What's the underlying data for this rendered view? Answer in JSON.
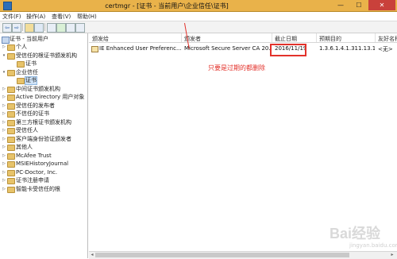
{
  "window": {
    "title": "certmgr - [证书 - 当前用户\\企业信任\\证书]",
    "minimize": "—",
    "maximize": "☐",
    "close": "✕"
  },
  "menu": [
    "文件(F)",
    "操作(A)",
    "查看(V)",
    "帮助(H)"
  ],
  "toolbar": {
    "buttons": [
      "back",
      "forward",
      "up-folder",
      "show-tree",
      "copy",
      "refresh",
      "export",
      "help"
    ],
    "back_glyph": "⇦",
    "forward_glyph": "⇨"
  },
  "tree": {
    "root": "证书 - 当前用户",
    "items": [
      {
        "label": "个人",
        "level": 1,
        "expander": "▷"
      },
      {
        "label": "受信任的根证书颁发机构",
        "level": 1,
        "expander": "▾"
      },
      {
        "label": "证书",
        "level": 2,
        "expander": ""
      },
      {
        "label": "企业信任",
        "level": 1,
        "expander": "▾"
      },
      {
        "label": "证书",
        "level": 2,
        "expander": "",
        "selected": true
      },
      {
        "label": "中间证书颁发机构",
        "level": 1,
        "expander": "▷"
      },
      {
        "label": "Active Directory 用户对象",
        "level": 1,
        "expander": "▷"
      },
      {
        "label": "受信任的发布者",
        "level": 1,
        "expander": "▷"
      },
      {
        "label": "不信任的证书",
        "level": 1,
        "expander": "▷"
      },
      {
        "label": "第三方根证书颁发机构",
        "level": 1,
        "expander": "▷"
      },
      {
        "label": "受信任人",
        "level": 1,
        "expander": "▷"
      },
      {
        "label": "客户端身份验证颁发者",
        "level": 1,
        "expander": "▷"
      },
      {
        "label": "其他人",
        "level": 1,
        "expander": "▷"
      },
      {
        "label": "McAfee Trust",
        "level": 1,
        "expander": "▷"
      },
      {
        "label": "MSIEHistoryJournal",
        "level": 1,
        "expander": "▷"
      },
      {
        "label": "PC-Doctor, Inc.",
        "level": 1,
        "expander": "▷"
      },
      {
        "label": "证书注册申请",
        "level": 1,
        "expander": "▷"
      },
      {
        "label": "智能卡受信任的根",
        "level": 1,
        "expander": "▷"
      }
    ]
  },
  "list": {
    "columns": [
      "颁发给",
      "颁发者",
      "截止日期",
      "预期目的",
      "友好名称"
    ],
    "rows": [
      [
        "IE Enhanced User Preferenc...",
        "Microsoft Secure Server CA 20...",
        "2016/11/19",
        "1.3.6.1.4.1.311.13.1",
        "<无>"
      ]
    ]
  },
  "annotation": "只要是过期的都删除",
  "watermark": {
    "text": "Bai经验",
    "sub": "jingyan.baidu.com"
  },
  "colors": {
    "titlebar": "#e9b24a",
    "close": "#c9413b",
    "annotation": "#e3322b"
  }
}
